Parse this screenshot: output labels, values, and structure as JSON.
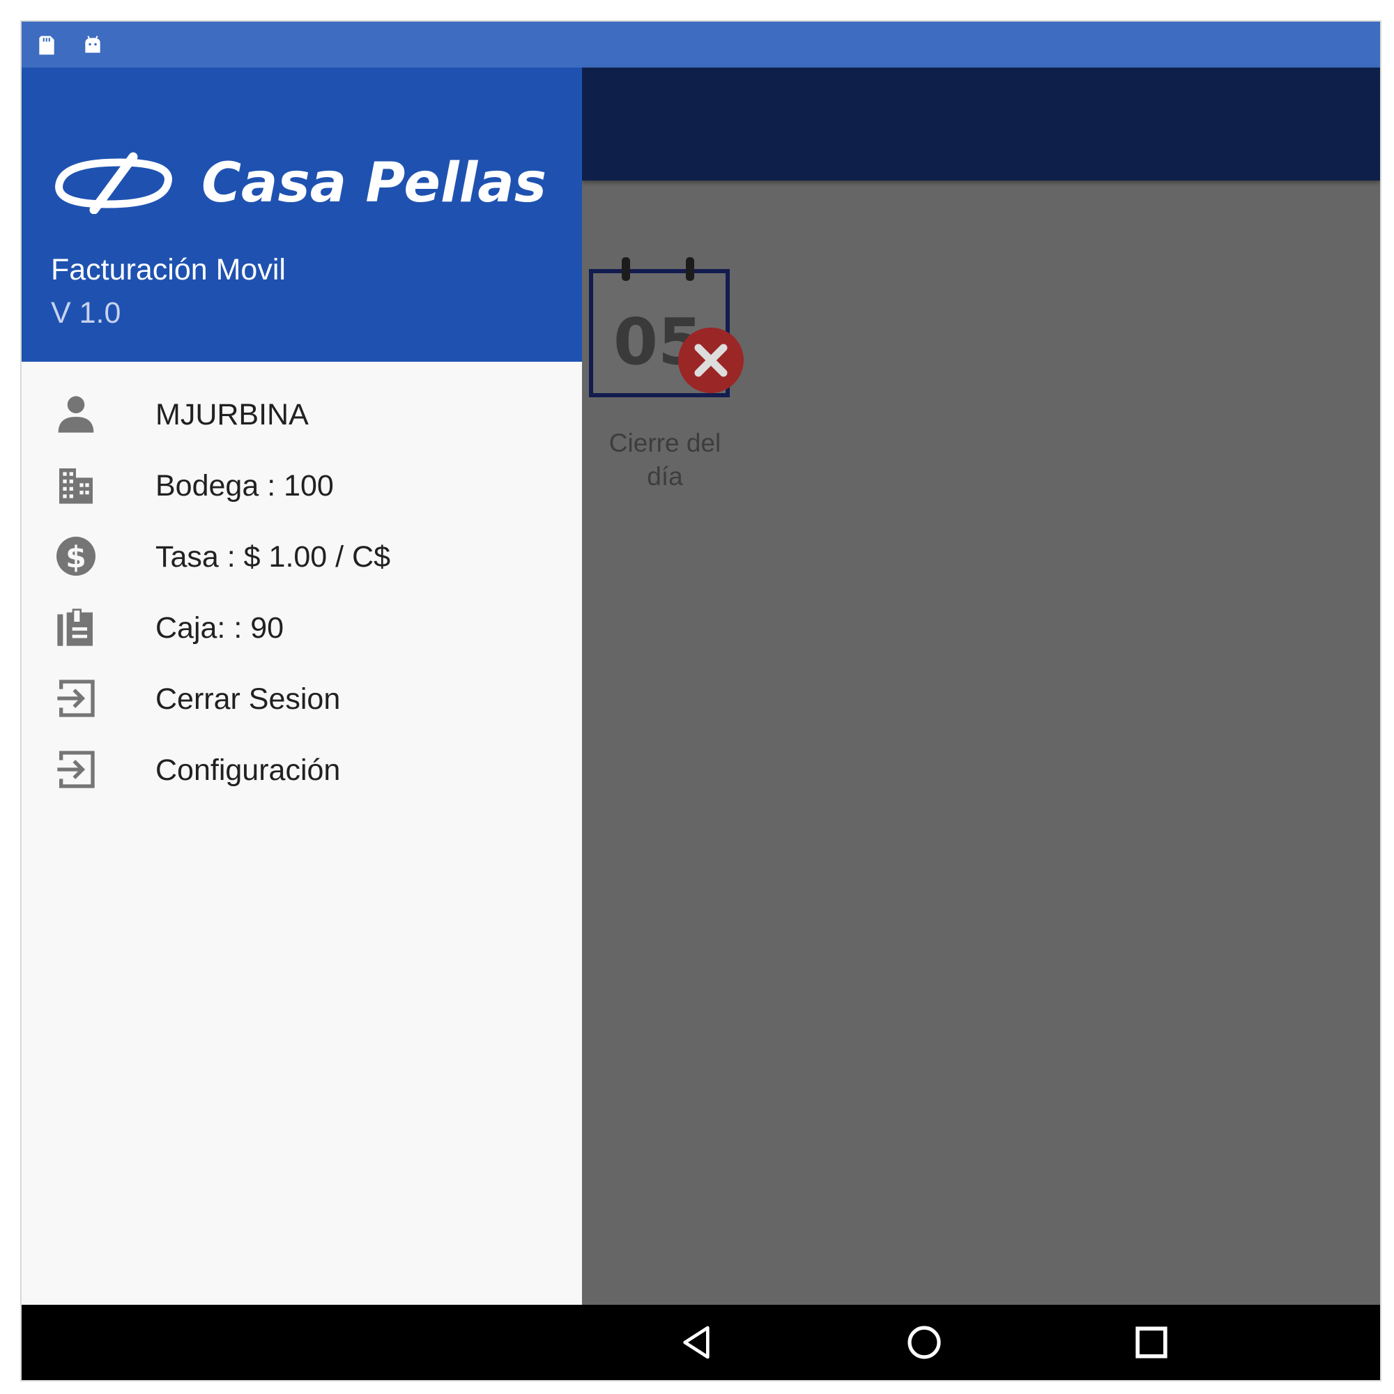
{
  "status_bar": {
    "icons": [
      "sd-card-icon",
      "android-icon"
    ]
  },
  "drawer": {
    "brand": "Casa Pellas",
    "app_name": "Facturación Movil",
    "version": "V 1.0",
    "items": [
      {
        "icon": "person-icon",
        "label": "MJURBINA"
      },
      {
        "icon": "building-icon",
        "label": "Bodega : 100"
      },
      {
        "icon": "dollar-icon",
        "label": "Tasa : $  1.00 / C$"
      },
      {
        "icon": "clipboard-icon",
        "label": "Caja: : 90"
      },
      {
        "icon": "logout-icon",
        "label": "Cerrar Sesion"
      },
      {
        "icon": "logout-icon",
        "label": "Configuración"
      }
    ]
  },
  "main": {
    "tile": {
      "calendar_day": "05",
      "label_line1": "Cierre del",
      "label_line2": "día"
    }
  },
  "nav_bar": {
    "buttons": [
      "back-icon",
      "home-icon",
      "recents-icon"
    ]
  },
  "colors": {
    "status_bar": "#3d6cc0",
    "drawer_header": "#1f52b0",
    "toolbar": "#0e2049",
    "scrim": "#666666",
    "close_badge": "#9b2626"
  }
}
